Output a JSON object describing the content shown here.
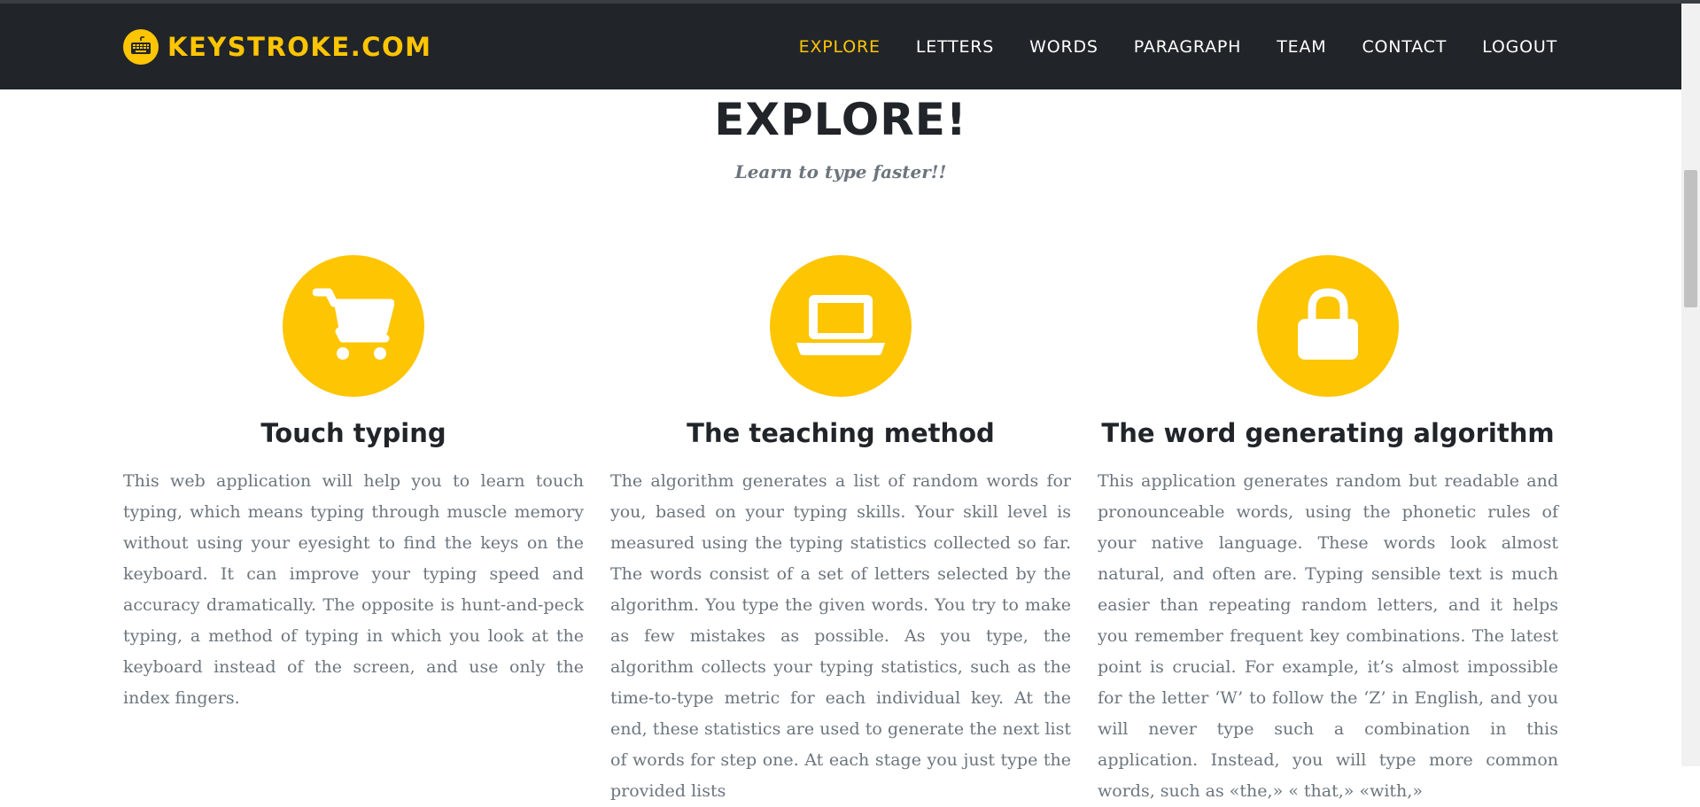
{
  "brand": {
    "name": "KEYSTROKE.COM",
    "logo_icon": "keyboard-logo-icon"
  },
  "nav": {
    "items": [
      {
        "label": "EXPLORE",
        "active": true
      },
      {
        "label": "LETTERS",
        "active": false
      },
      {
        "label": "WORDS",
        "active": false
      },
      {
        "label": "PARAGRAPH",
        "active": false
      },
      {
        "label": "TEAM",
        "active": false
      },
      {
        "label": "CONTACT",
        "active": false
      },
      {
        "label": "LOGOUT",
        "active": false
      }
    ]
  },
  "section": {
    "heading": "EXPLORE!",
    "subheading": "Learn to type faster!!"
  },
  "features": [
    {
      "icon": "shopping-cart-icon",
      "title": "Touch typing",
      "text": "This web application will help you to learn touch typing, which means typing through muscle memory without using your eyesight to find the keys on the keyboard. It can improve your typing speed and accuracy dramatically. The opposite is hunt-and-peck typing, a method of typing in which you look at the keyboard instead of the screen, and use only the index fingers."
    },
    {
      "icon": "laptop-icon",
      "title": "The teaching method",
      "text": "The algorithm generates a list of random words for you, based on your typing skills. Your skill level is measured using the typing statistics collected so far. The words consist of a set of letters selected by the algorithm. You type the given words. You try to make as few mistakes as possible. As you type, the algorithm collects your typing statistics, such as the time-to-type metric for each individual key. At the end, these statistics are used to generate the next list of words for step one. At each stage you just type the provided lists"
    },
    {
      "icon": "lock-icon",
      "title": "The word generating algorithm",
      "text": "This application generates random but readable and pronounceable words, using the phonetic rules of your native language. These words look almost natural, and often are. Typing sensible text is much easier than repeating random letters, and it helps you remember frequent key combinations. The latest point is crucial. For example, it’s almost impossible for the letter ‘W’ to follow the ‘Z’ in English, and you will never type such a combination in this application. Instead, you will type more common words, such as «the,» « that,» «with,»"
    }
  ],
  "colors": {
    "accent": "#fec503",
    "navbar_bg": "#212529",
    "heading": "#212529",
    "body_text": "#6c757d"
  }
}
